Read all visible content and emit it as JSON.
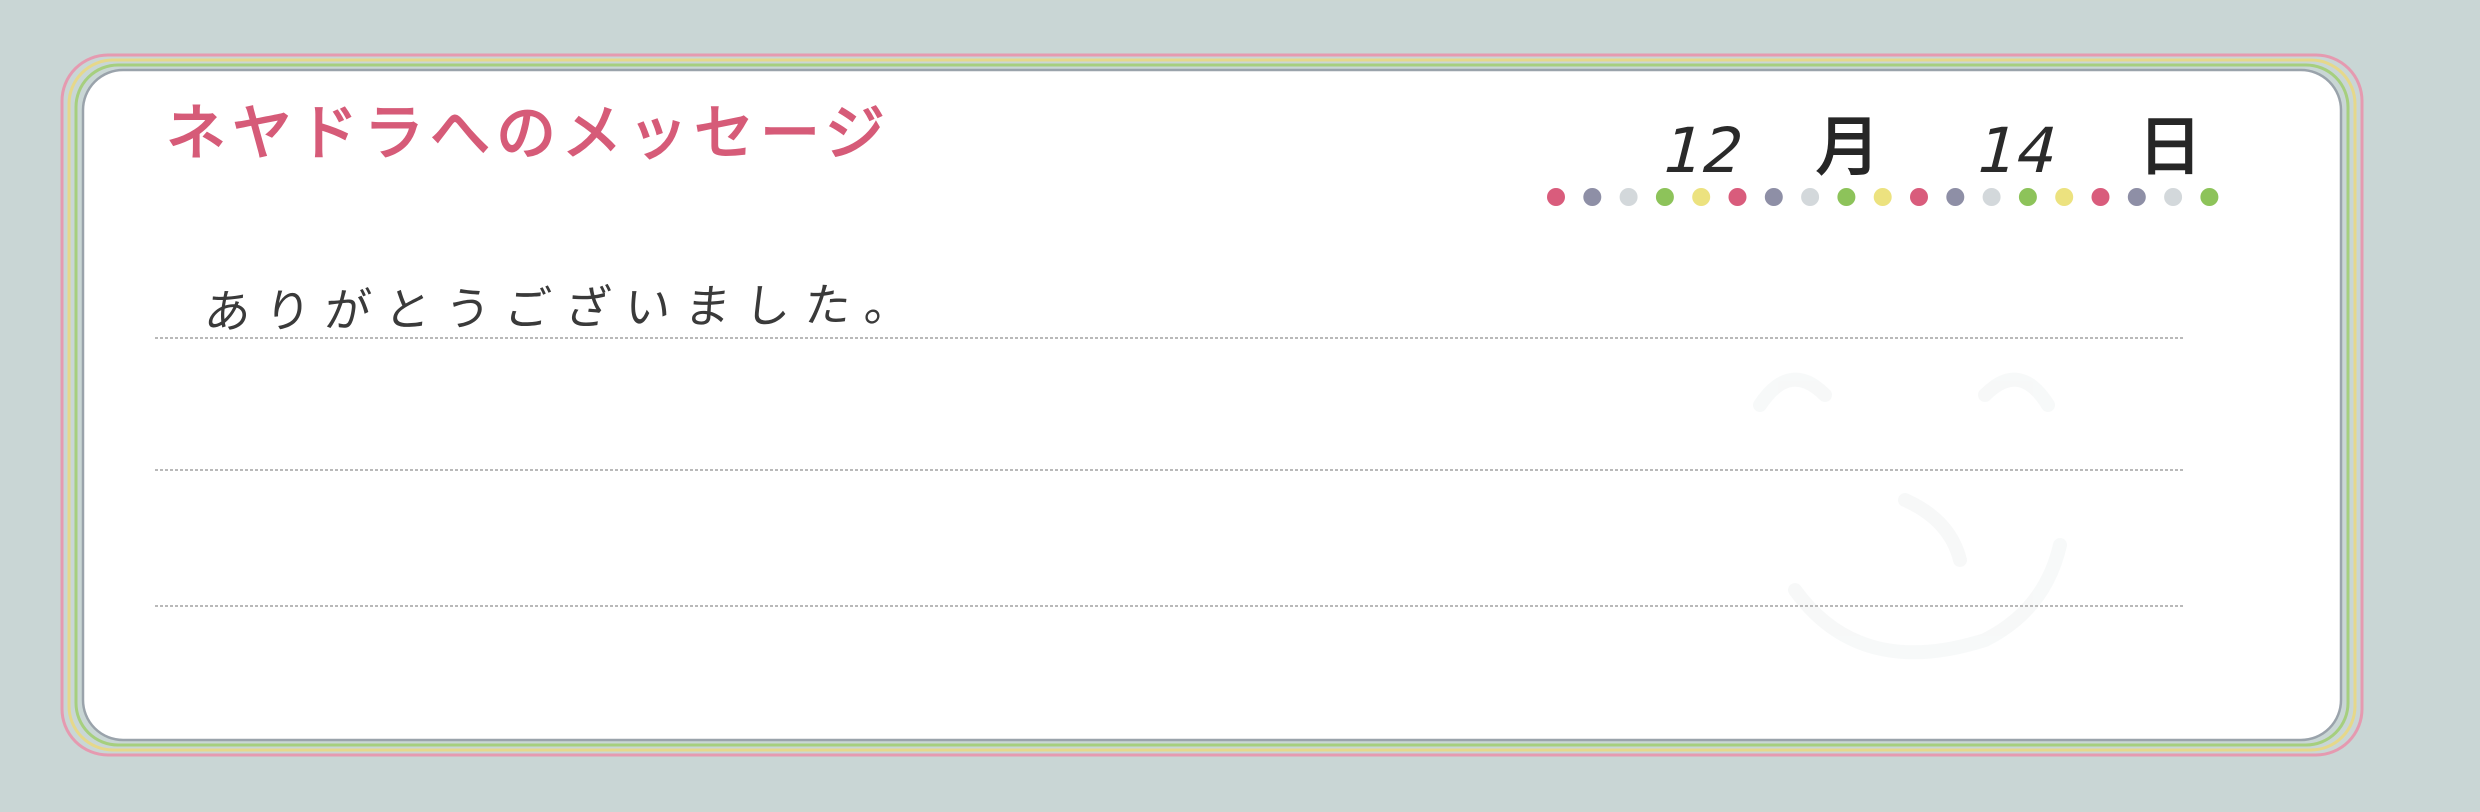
{
  "card": {
    "title": "ネヤドラへのメッセージ",
    "date": {
      "month_value": "12",
      "month_unit": "月",
      "day_value": "14",
      "day_unit": "日"
    },
    "message_lines": [
      "ありがとうございました。",
      "",
      ""
    ]
  },
  "colors": {
    "background": "#c9d6d5",
    "title": "#d65b78",
    "border_pink": "#e59ab0",
    "border_yellow": "#e6d88a",
    "border_green": "#a6cf7e",
    "border_grey": "#9aa3ab",
    "dots": [
      "#d95c7c",
      "#8e8fa6",
      "#d3d8db",
      "#8dc35a",
      "#ece27f",
      "#d95c7c",
      "#8e8fa6",
      "#d3d8db",
      "#8dc35a",
      "#ece27f",
      "#d95c7c",
      "#8e8fa6",
      "#d3d8db",
      "#8dc35a",
      "#ece27f",
      "#d95c7c",
      "#8e8fa6",
      "#d3d8db",
      "#8dc35a"
    ]
  },
  "icons": {
    "watermark": "smiley-face-icon"
  }
}
